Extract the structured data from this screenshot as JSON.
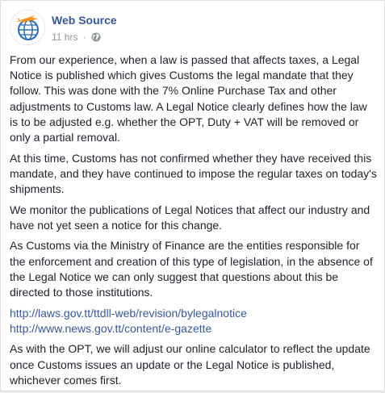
{
  "post": {
    "page_name": "Web Source",
    "timestamp": "11 hrs",
    "separator": "·",
    "privacy_icon": "globe-icon",
    "paragraphs": [
      "From our experience, when a law is passed that affects taxes, a Legal Notice is published which gives Customs the legal mandate that they follow. This was done with the 7% Online Purchase Tax and other adjustments to Customs law. A Legal Notice clearly defines how the law is to be adjusted e.g. whether the OPT, Duty + VAT will be removed or only a partial removal.",
      "At this time, Customs has not confirmed whether they have received this mandate, and they have continued to impose the regular taxes on today's shipments.",
      "We monitor the publications of Legal Notices that affect our industry and have not yet seen a notice for this change.",
      "As Customs via the Ministry of Finance are the entities responsible for the enforcement and creation of this type of legislation, in the absence of the Legal Notice we can only suggest that questions about this be directed to those institutions."
    ],
    "links": [
      "http://laws.gov.tt/ttdll-web/revision/bylegalnotice",
      "http://www.news.gov.tt/content/e-gazette"
    ],
    "closing": "As with the OPT, we will adjust our online calculator to reflect the update once Customs issues an update or the Legal Notice is published, whichever comes first."
  },
  "colors": {
    "page_name": "#365899",
    "link": "#365899",
    "meta": "#90949c",
    "text": "#1d2129",
    "logo_orange": "#f7931e",
    "logo_blue": "#2a6db5"
  }
}
